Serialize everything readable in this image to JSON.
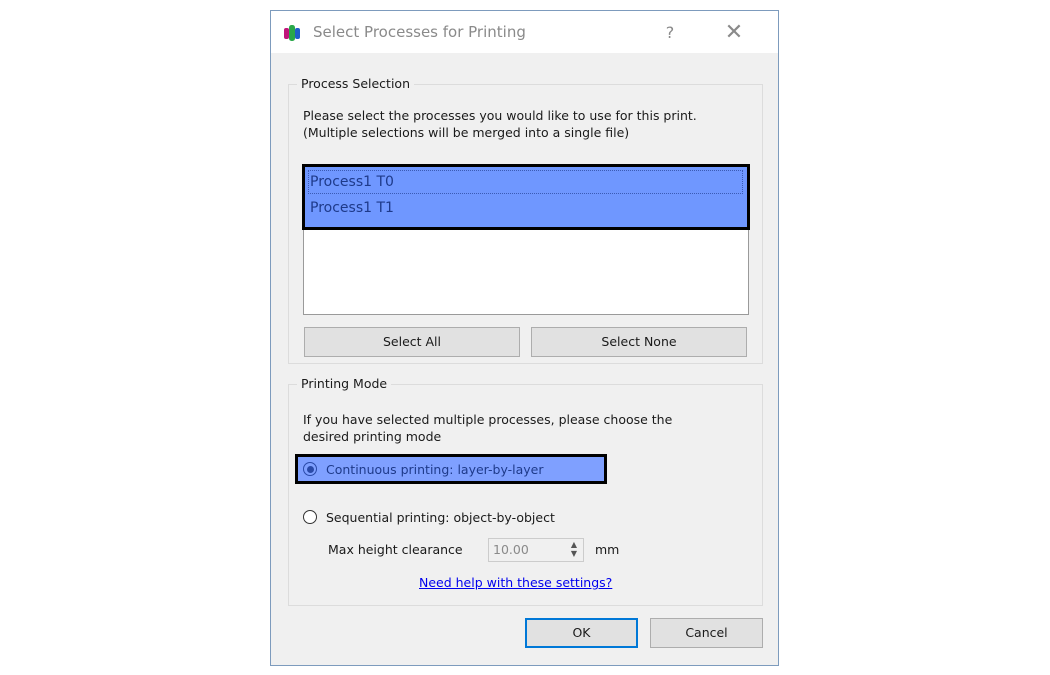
{
  "window": {
    "title": "Select Processes for Printing",
    "help_label": "?",
    "close_label": "✕"
  },
  "process_selection": {
    "group_label": "Process Selection",
    "description_line1": "Please select the processes you would like to use for this print.",
    "description_line2": "(Multiple selections will be merged into a single file)",
    "items": [
      {
        "label": "Process1 T0",
        "selected": true
      },
      {
        "label": "Process1 T1",
        "selected": true
      }
    ],
    "select_all_label": "Select All",
    "select_none_label": "Select None"
  },
  "printing_mode": {
    "group_label": "Printing Mode",
    "description_line1": "If you have selected multiple processes, please choose the",
    "description_line2": "desired printing mode",
    "options": [
      {
        "label": "Continuous printing: layer-by-layer",
        "checked": true
      },
      {
        "label": "Sequential printing: object-by-object",
        "checked": false
      }
    ],
    "max_height_label": "Max height clearance",
    "max_height_value": "10.00",
    "max_height_unit": "mm",
    "help_link": "Need help with these settings?"
  },
  "footer": {
    "ok_label": "OK",
    "cancel_label": "Cancel"
  }
}
